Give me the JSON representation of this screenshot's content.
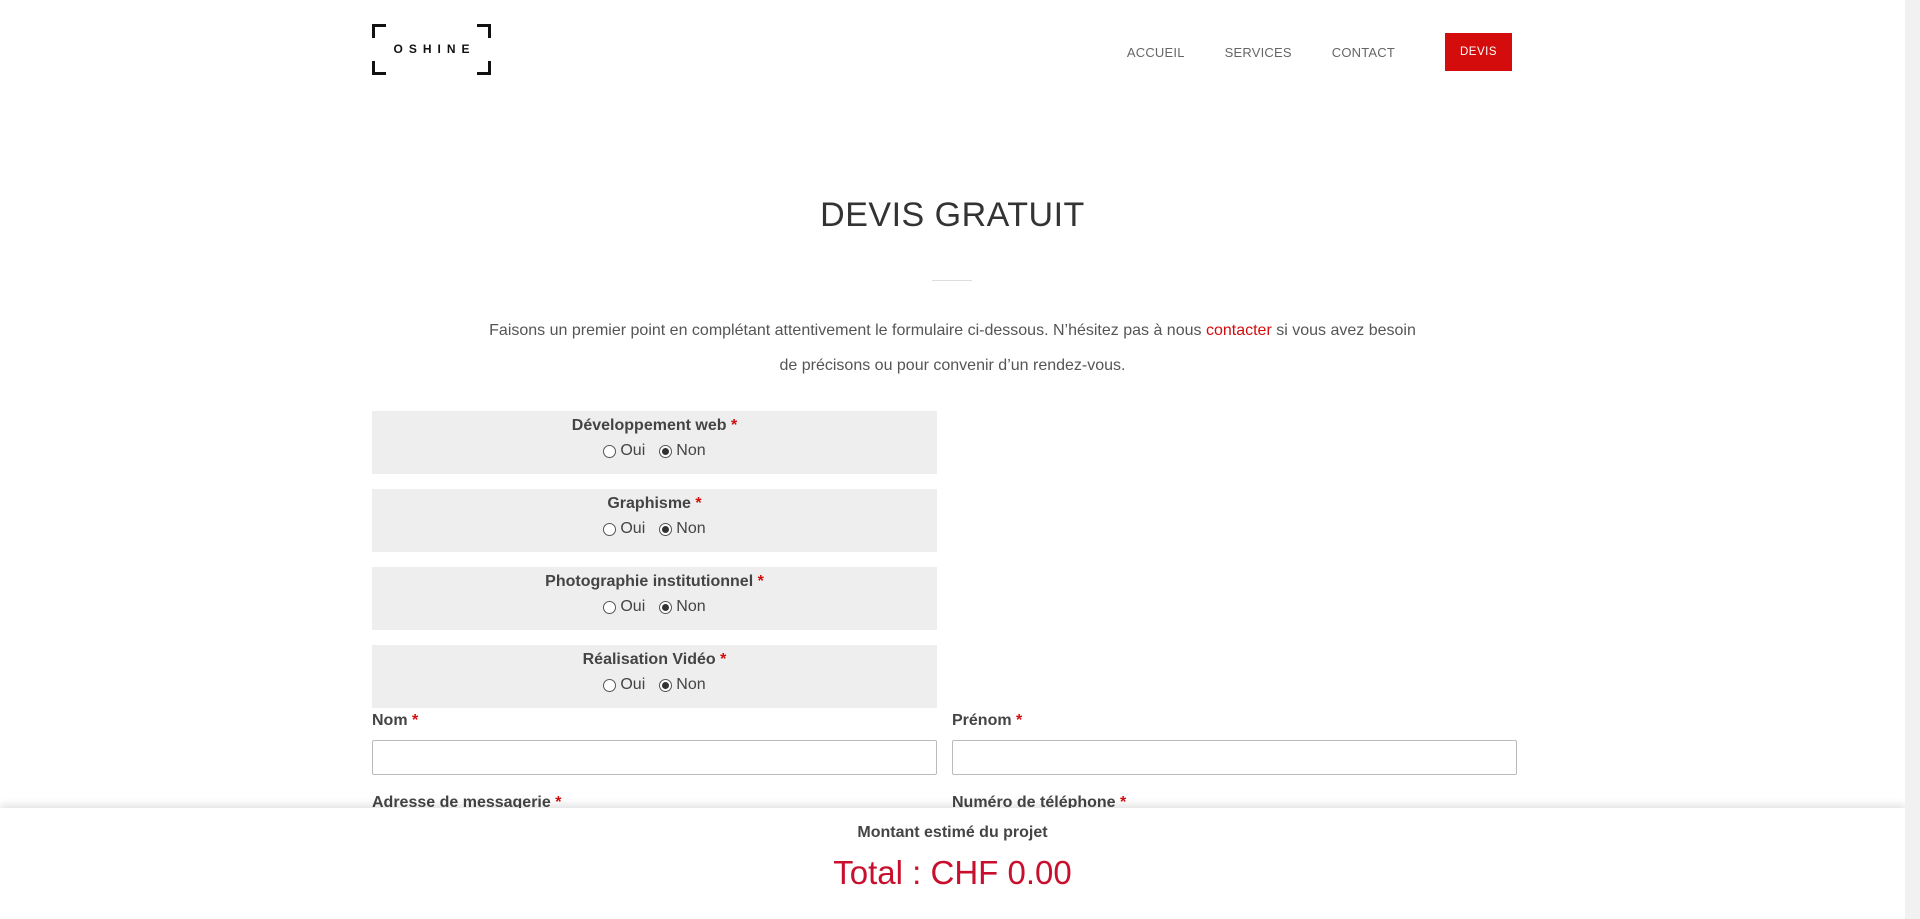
{
  "logo": {
    "text": "OSHINE"
  },
  "nav": {
    "items": [
      "ACCUEIL",
      "SERVICES",
      "CONTACT"
    ],
    "devis": "DEVIS"
  },
  "title": "DEVIS GRATUIT",
  "intro": {
    "before": "Faisons un premier point en complétant attentivement le formulaire ci-dessous. N’hésitez pas à nous ",
    "link": "contacter",
    "after": " si vous avez besoin de précisons ou pour convenir d’un rendez-vous."
  },
  "questions": [
    {
      "label": "Développement web",
      "required": "*",
      "yes": "Oui",
      "no": "Non",
      "selected": "no"
    },
    {
      "label": "Graphisme",
      "required": "*",
      "yes": "Oui",
      "no": "Non",
      "selected": "no"
    },
    {
      "label": "Photographie institutionnel",
      "required": "*",
      "yes": "Oui",
      "no": "Non",
      "selected": "no"
    },
    {
      "label": "Réalisation Vidéo",
      "required": "*",
      "yes": "Oui",
      "no": "Non",
      "selected": "no"
    }
  ],
  "fields": {
    "nom": "Nom",
    "prenom": "Prénom",
    "email": "Adresse de messagerie",
    "telephone": "Numéro de téléphone",
    "required": "*"
  },
  "estimate": {
    "label": "Montant estimé du projet",
    "total": "Total : CHF 0.00"
  },
  "colors": {
    "accent": "#d40c0c",
    "box_bg": "#eeeeee"
  }
}
